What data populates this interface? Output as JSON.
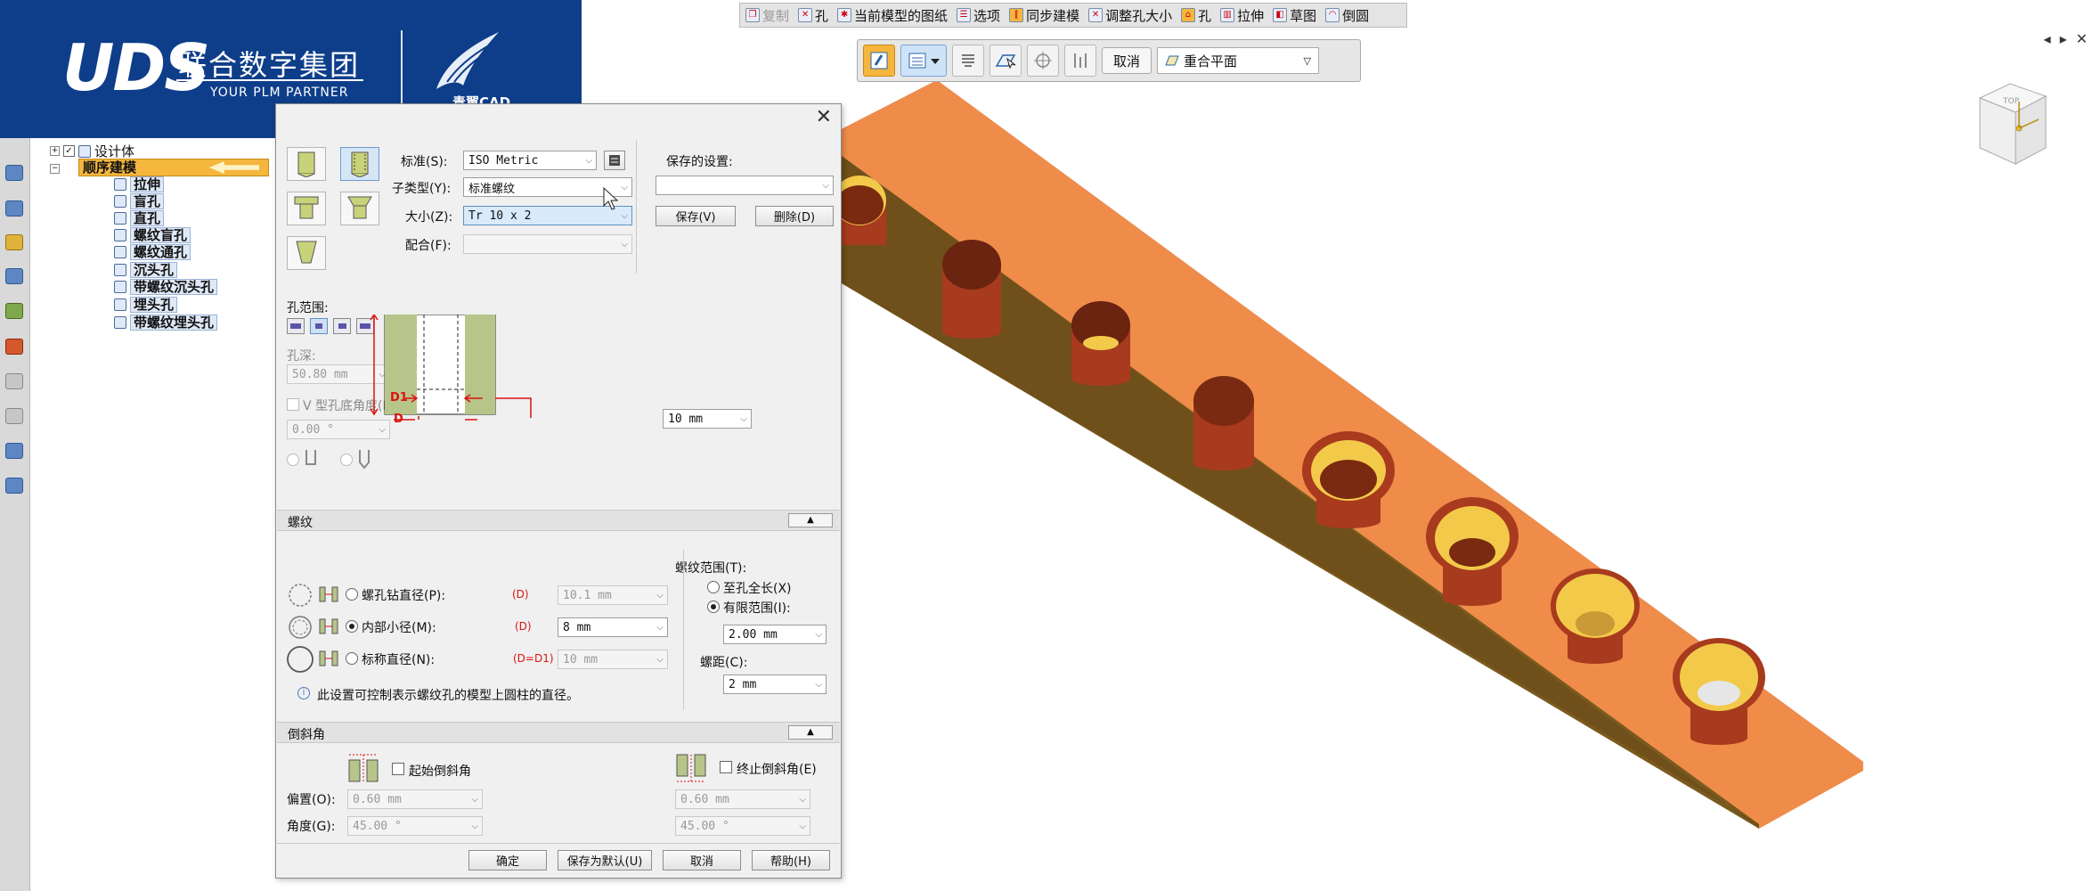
{
  "brand": {
    "logo": "UDS",
    "company": "联合数字集团",
    "tagline": "YOUR PLM PARTNER",
    "product": "青翼CAD"
  },
  "topbar": {
    "items": [
      {
        "label": "复制",
        "icon": "copy-icon",
        "disabled": true
      },
      {
        "label": "孔",
        "icon": "hole-icon"
      },
      {
        "label": "当前模型的图纸",
        "icon": "drawing-icon"
      },
      {
        "label": "选项",
        "icon": "options-icon"
      },
      {
        "label": "同步建模",
        "icon": "sync-modeling-icon"
      },
      {
        "label": "调整孔大小",
        "icon": "resize-hole-icon"
      },
      {
        "label": "孔",
        "icon": "hole-icon"
      },
      {
        "label": "拉伸",
        "icon": "extrude-icon"
      },
      {
        "label": "草图",
        "icon": "sketch-icon"
      },
      {
        "label": "倒圆",
        "icon": "round-icon"
      }
    ]
  },
  "window_controls": {
    "prev": "◂",
    "next": "▸",
    "close": "✕"
  },
  "command_bar": {
    "cancel_label": "取消",
    "plane_value": "重合平面"
  },
  "tree": {
    "design_body": "设计体",
    "sequential": "顺序建模",
    "features": [
      "拉伸",
      "盲孔",
      "直孔",
      "螺纹盲孔",
      "螺纹通孔",
      "沉头孔",
      "带螺纹沉头孔",
      "埋头孔",
      "带螺纹埋头孔"
    ]
  },
  "dialog": {
    "standard_label": "标准(S):",
    "standard_value": "ISO Metric",
    "subtype_label": "子类型(Y):",
    "subtype_value": "标准螺纹",
    "size_label": "大小(Z):",
    "size_value": "Tr 10 x 2",
    "fit_label": "配合(F):",
    "fit_value": "",
    "saved_settings_label": "保存的设置:",
    "saved_settings_value": "",
    "save_button": "保存(V)",
    "delete_button": "删除(D)",
    "hole_range_label": "孔范围:",
    "hole_depth_label": "孔深:",
    "hole_depth_value": "50.80 mm",
    "v_angle_label": "V 型孔底角度(B):",
    "v_angle_value": "0.00 °",
    "diagram_d1": "D1",
    "diagram_d": "D",
    "diameter_value": "10 mm",
    "thread_section": "螺纹",
    "thread_range_label": "螺纹范围(T):",
    "full_length_label": "至孔全长(X)",
    "finite_range_label": "有限范围(I):",
    "finite_range_value": "2.00 mm",
    "pitch_label": "螺距(C):",
    "pitch_value": "2 mm",
    "tap_drill_label": "螺孔钻直径(P):",
    "tap_drill_tag": "(D)",
    "tap_drill_value": "10.1 mm",
    "minor_dia_label": "内部小径(M):",
    "minor_dia_tag": "(D)",
    "minor_dia_value": "8 mm",
    "nominal_dia_label": "标称直径(N):",
    "nominal_dia_tag": "(D=D1)",
    "nominal_dia_value": "10 mm",
    "info_text": "此设置可控制表示螺纹孔的模型上圆柱的直径。",
    "chamfer_section": "倒斜角",
    "start_chamfer_label": "起始倒斜角",
    "end_chamfer_label": "终止倒斜角(E)",
    "offset_label": "偏置(O):",
    "offset_start_value": "0.60 mm",
    "offset_end_value": "0.60 mm",
    "angle_label": "角度(G):",
    "angle_start_value": "45.00 °",
    "angle_end_value": "45.00 °",
    "ok_button": "确定",
    "save_default_button": "保存为默认(U)",
    "cancel_button": "取消",
    "help_button": "帮助(H)",
    "close_glyph": "✕"
  },
  "view_cube": {
    "label": "TOP"
  },
  "colors": {
    "brand_blue": "#0e3e8a",
    "part_face": "#f08c4a",
    "part_edge": "#8a2a14",
    "hole_wall": "#a83a1e",
    "hole_bottom": "#f3c94a",
    "accent_orange": "#f5b63d"
  }
}
